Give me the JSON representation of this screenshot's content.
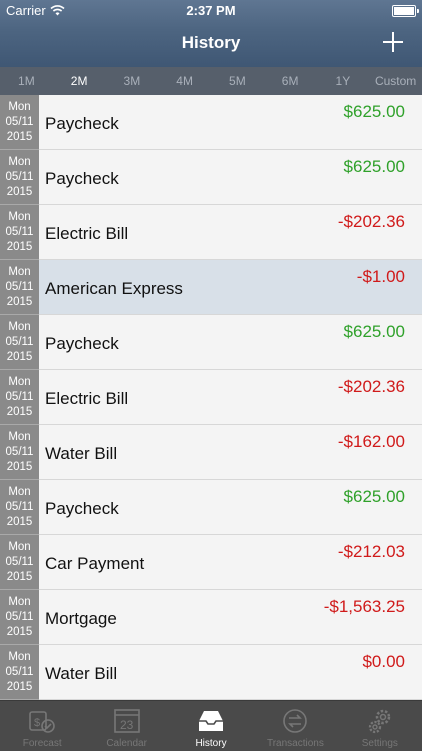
{
  "status": {
    "carrier": "Carrier",
    "time": "2:37 PM"
  },
  "header": {
    "title": "History"
  },
  "ranges": [
    "1M",
    "2M",
    "3M",
    "4M",
    "5M",
    "6M",
    "1Y",
    "Custom"
  ],
  "active_range": "2M",
  "transactions": [
    {
      "day": "Mon",
      "date": "05/11",
      "year": "2015",
      "description": "Paycheck",
      "amount": "$625.00",
      "type": "credit"
    },
    {
      "day": "Mon",
      "date": "05/11",
      "year": "2015",
      "description": "Paycheck",
      "amount": "$625.00",
      "type": "credit"
    },
    {
      "day": "Mon",
      "date": "05/11",
      "year": "2015",
      "description": "Electric Bill",
      "amount": "-$202.36",
      "type": "debit"
    },
    {
      "day": "Mon",
      "date": "05/11",
      "year": "2015",
      "description": "American Express",
      "amount": "-$1.00",
      "type": "debit",
      "selected": true
    },
    {
      "day": "Mon",
      "date": "05/11",
      "year": "2015",
      "description": "Paycheck",
      "amount": "$625.00",
      "type": "credit"
    },
    {
      "day": "Mon",
      "date": "05/11",
      "year": "2015",
      "description": "Electric Bill",
      "amount": "-$202.36",
      "type": "debit"
    },
    {
      "day": "Mon",
      "date": "05/11",
      "year": "2015",
      "description": "Water Bill",
      "amount": "-$162.00",
      "type": "debit"
    },
    {
      "day": "Mon",
      "date": "05/11",
      "year": "2015",
      "description": "Paycheck",
      "amount": "$625.00",
      "type": "credit"
    },
    {
      "day": "Mon",
      "date": "05/11",
      "year": "2015",
      "description": "Car Payment",
      "amount": "-$212.03",
      "type": "debit"
    },
    {
      "day": "Mon",
      "date": "05/11",
      "year": "2015",
      "description": "Mortgage",
      "amount": "-$1,563.25",
      "type": "debit"
    },
    {
      "day": "Mon",
      "date": "05/11",
      "year": "2015",
      "description": "Water Bill",
      "amount": "$0.00",
      "type": "debit"
    }
  ],
  "tabs": [
    {
      "label": "Forecast",
      "icon": "forecast-icon"
    },
    {
      "label": "Calendar",
      "icon": "calendar-icon",
      "calendar_day": "23"
    },
    {
      "label": "History",
      "icon": "inbox-icon",
      "active": true
    },
    {
      "label": "Transactions",
      "icon": "transactions-icon"
    },
    {
      "label": "Settings",
      "icon": "settings-icon"
    }
  ],
  "colors": {
    "credit": "#2fa12a",
    "debit": "#d01a1a",
    "header": "#4d6581",
    "tab_bar": "#4a4a4a"
  }
}
